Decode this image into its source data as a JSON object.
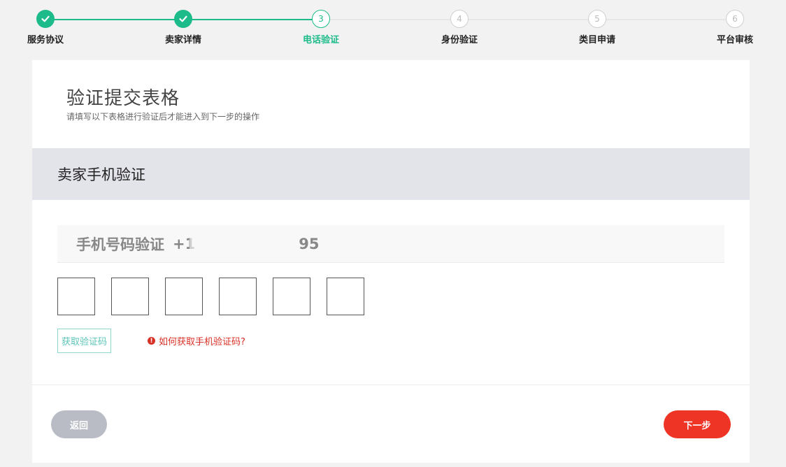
{
  "stepper": {
    "colors": {
      "done": "#1dbb8a",
      "active": "#1dbb8a",
      "todo": "#cfcfcf"
    },
    "steps": [
      {
        "number": "",
        "label": "服务协议",
        "state": "done",
        "icon": "check-icon"
      },
      {
        "number": "",
        "label": "卖家详情",
        "state": "done",
        "icon": "check-icon"
      },
      {
        "number": "3",
        "label": "电话验证",
        "state": "active"
      },
      {
        "number": "4",
        "label": "身份验证",
        "state": "todo"
      },
      {
        "number": "5",
        "label": "类目申请",
        "state": "todo"
      },
      {
        "number": "6",
        "label": "平台审核",
        "state": "todo"
      }
    ]
  },
  "form": {
    "title": "验证提交表格",
    "subtitle": "请填写以下表格进行验证后才能进入到下一步的操作",
    "section_title": "卖家手机验证",
    "phone_label": "手机号码验证",
    "phone_prefix": "+1",
    "phone_suffix": "95",
    "code_digits": [
      "",
      "",
      "",
      "",
      "",
      ""
    ],
    "get_code_label": "获取验证码",
    "help_link": "如何获取手机验证码?",
    "help_icon": "warning-circle-icon"
  },
  "footer": {
    "back_label": "返回",
    "next_label": "下一步",
    "colors": {
      "back": "#b9bcc4",
      "next": "#ee3424"
    }
  }
}
